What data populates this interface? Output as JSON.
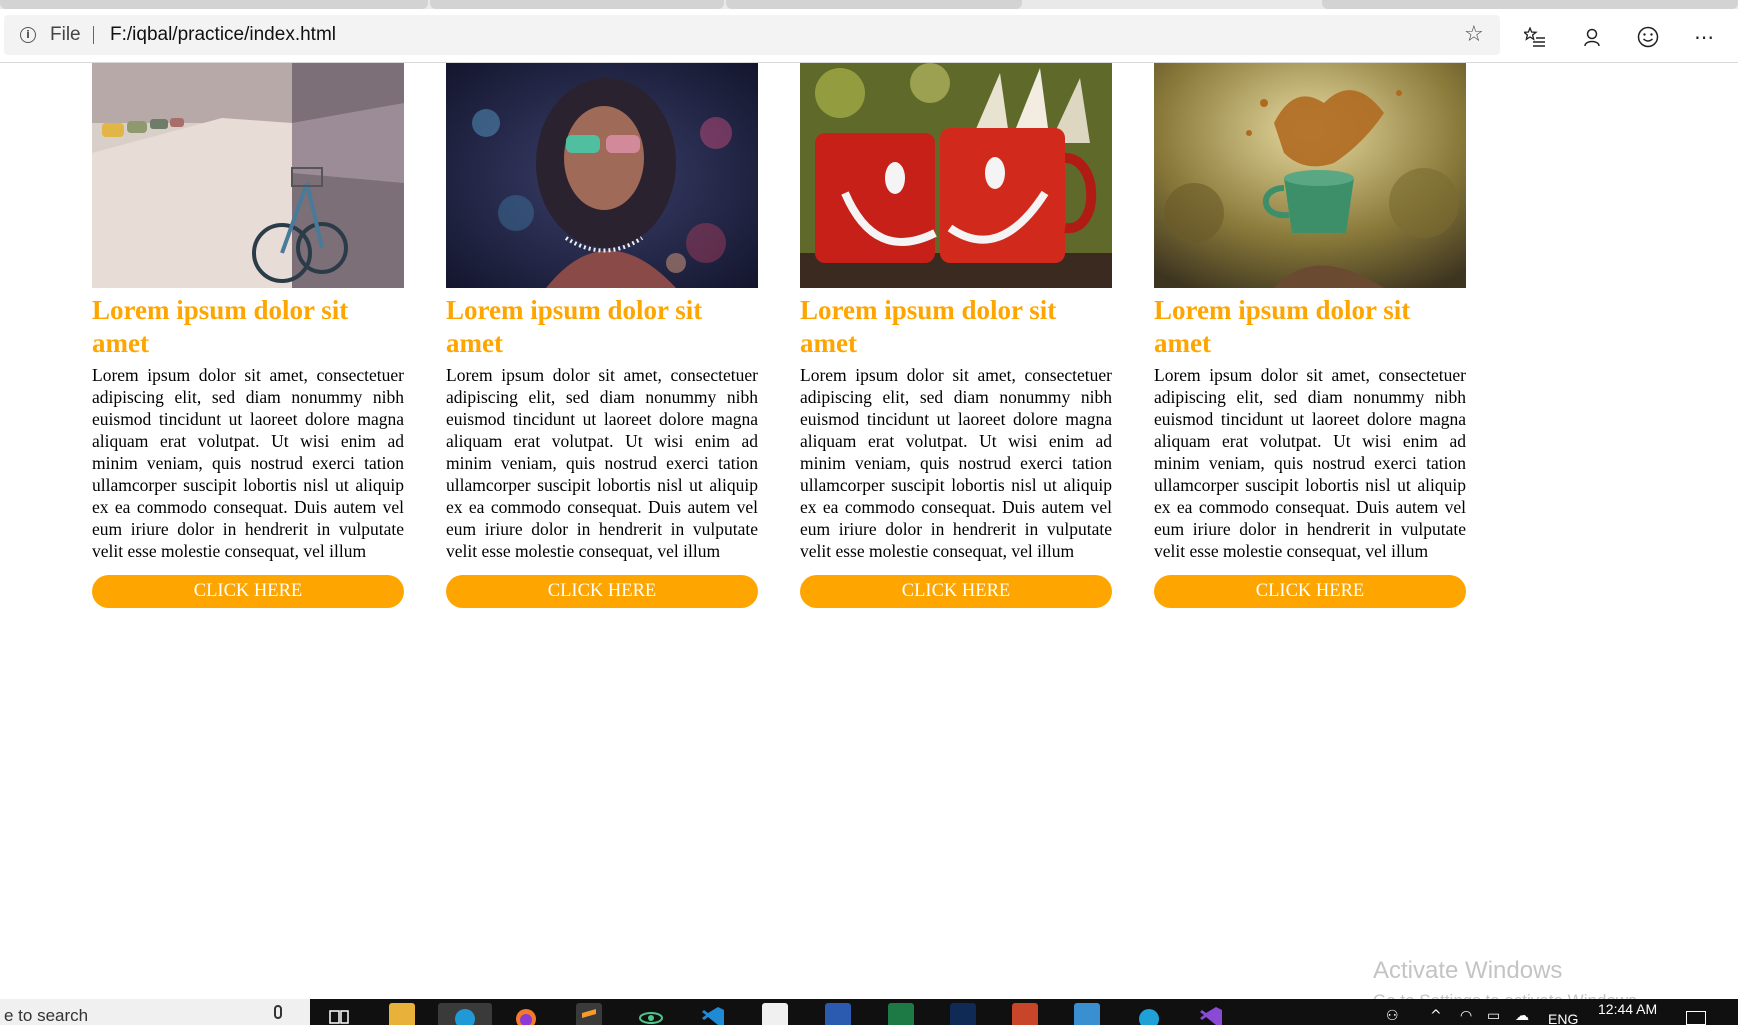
{
  "browser": {
    "info_icon": "info-icon",
    "scheme_label": "File",
    "url": "F:/iqbal/practice/index.html",
    "favorite_icon": "star-outline-icon",
    "toolbar_icons": [
      "favorites-list-icon",
      "profile-icon",
      "feedback-smiley-icon",
      "more-ellipsis-icon"
    ]
  },
  "cards": [
    {
      "image": "street-bicycle-photo",
      "title": "Lorem ipsum dolor sit amet",
      "body": "Lorem ipsum dolor sit amet, consectetuer adipiscing elit, sed diam nonummy nibh euismod tincidunt ut laoreet dolore magna aliquam erat volutpat. Ut wisi enim ad minim veniam, quis nostrud exerci tation ullamcorper suscipit lobortis nisl ut aliquip ex ea commodo consequat. Duis autem vel eum iriure dolor in hendrerit in vulputate velit esse molestie consequat, vel illum",
      "button": "CLICK HERE"
    },
    {
      "image": "woman-sunglasses-bokeh-photo",
      "title": "Lorem ipsum dolor sit amet",
      "body": "Lorem ipsum dolor sit amet, consectetuer adipiscing elit, sed diam nonummy nibh euismod tincidunt ut laoreet dolore magna aliquam erat volutpat. Ut wisi enim ad minim veniam, quis nostrud exerci tation ullamcorper suscipit lobortis nisl ut aliquip ex ea commodo consequat. Duis autem vel eum iriure dolor in hendrerit in vulputate velit esse molestie consequat, vel illum",
      "button": "CLICK HERE"
    },
    {
      "image": "red-smiley-mugs-photo",
      "title": "Lorem ipsum dolor sit amet",
      "body": "Lorem ipsum dolor sit amet, consectetuer adipiscing elit, sed diam nonummy nibh euismod tincidunt ut laoreet dolore magna aliquam erat volutpat. Ut wisi enim ad minim veniam, quis nostrud exerci tation ullamcorper suscipit lobortis nisl ut aliquip ex ea commodo consequat. Duis autem vel eum iriure dolor in hendrerit in vulputate velit esse molestie consequat, vel illum",
      "button": "CLICK HERE"
    },
    {
      "image": "coffee-splash-cup-photo",
      "title": "Lorem ipsum dolor sit amet",
      "body": "Lorem ipsum dolor sit amet, consectetuer adipiscing elit, sed diam nonummy nibh euismod tincidunt ut laoreet dolore magna aliquam erat volutpat. Ut wisi enim ad minim veniam, quis nostrud exerci tation ullamcorper suscipit lobortis nisl ut aliquip ex ea commodo consequat. Duis autem vel eum iriure dolor in hendrerit in vulputate velit esse molestie consequat, vel illum",
      "button": "CLICK HERE"
    }
  ],
  "watermark": {
    "title": "Activate Windows",
    "subtitle": "Go to Settings to activate Windows."
  },
  "taskbar": {
    "search_text": "e to search",
    "tray_lang": "ENG",
    "time": "12:44 AM"
  },
  "colors": {
    "accent": "#FFA500",
    "button_text": "#FFFFFF",
    "body_text": "#000000"
  }
}
